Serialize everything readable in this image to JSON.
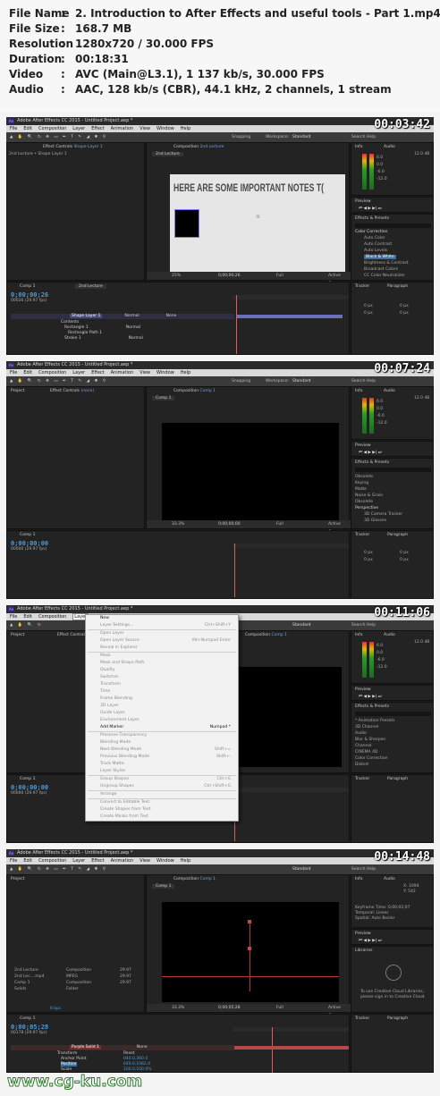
{
  "file_info": {
    "rows": [
      {
        "key": "File Name",
        "value": "2. Introduction to After Effects and useful tools - Part 1.mp4"
      },
      {
        "key": "File Size",
        "value": "168.7 MB"
      },
      {
        "key": "Resolution",
        "value": "1280x720 / 30.000 FPS"
      },
      {
        "key": "Duration",
        "value": "00:18:31"
      },
      {
        "key": "Video",
        "value": "AVC (Main@L3.1), 1 137 kb/s, 30.000 FPS"
      },
      {
        "key": "Audio",
        "value": "AAC, 128 kb/s (CBR), 44.1 kHz, 2 channels, 1 stream"
      }
    ]
  },
  "menu": [
    "File",
    "Edit",
    "Composition",
    "Layer",
    "Effect",
    "Animation",
    "View",
    "Window",
    "Help"
  ],
  "frames": [
    {
      "timestamp": "00:03:42",
      "title": "Adobe After Effects CC 2015 - Untitled Project.aep *",
      "left_tab": "Effect Controls",
      "left_tab_layer": "Shape Layer 1",
      "left_sub": "2nd Lecture • Shape Layer 1",
      "comp_tab": "Composition",
      "comp_name": "2nd Lecture",
      "comp_label": "2nd Lecture",
      "canvas_text": "HERE ARE SOME IMPORTANT NOTES T(",
      "zoom": "25%",
      "time_display": "0;00;00;26",
      "quality": "Full",
      "active_camera": "Active Cam",
      "tabs": [
        "Comp 1",
        "2nd Lecture"
      ],
      "timeline_time": "0;00;00;26",
      "timeline_sub": "00026 (29.97 fps)",
      "layer_rows": [
        "Shape Layer 1",
        "Contents",
        "Rectangle 1",
        "Rectangle Path 1",
        "Stroke 1"
      ],
      "blend": [
        "Normal",
        "Normal",
        "Normal"
      ],
      "parent": "None",
      "snapping": "Snapping",
      "workspace_label": "Workspace:",
      "workspace": "Standard",
      "search": "Search Help",
      "right_tabs": [
        "Info",
        "Audio"
      ],
      "audio_db": [
        "12.0 dB",
        "6.0",
        "0.0",
        "-6.0",
        "-12.0"
      ],
      "preview": "Preview",
      "effects_tab": "Effects & Presets",
      "effects_list": [
        "Color Correction",
        "Auto Color",
        "Auto Contrast",
        "Auto Levels",
        "Black & White",
        "Brightness & Contrast",
        "Broadcast Colors",
        "CC Color Neutralizer"
      ],
      "bottom_tabs": [
        "Tracker",
        "Paragraph"
      ],
      "px_vals": [
        "0 px",
        "0 px",
        "0 px",
        "0 px"
      ]
    },
    {
      "timestamp": "00:07:24",
      "title": "Adobe After Effects CC 2015 - Untitled Project.aep *",
      "left_tab": "Effect Controls",
      "left_tab_layer": "(none)",
      "left_tab_project": "Project",
      "comp_tab": "Composition",
      "comp_name": "Comp 1",
      "comp_label": "Comp 1",
      "zoom": "33.3%",
      "time_display": "0;00;00;00",
      "quality": "Full",
      "active_camera": "Active Cam",
      "tabs": [
        "Comp 1"
      ],
      "timeline_time": "0;00;00;00",
      "timeline_sub": "00000 (29.97 fps)",
      "snapping": "Snapping",
      "workspace_label": "Workspace:",
      "workspace": "Standard",
      "search": "Search Help",
      "right_tabs": [
        "Info",
        "Audio"
      ],
      "audio_db": [
        "12.0 dB",
        "6.0",
        "0.0",
        "-6.0",
        "-12.0"
      ],
      "preview": "Preview",
      "effects_tab": "Effects & Presets",
      "effects_list": [
        "Obsolete",
        "Keying",
        "Matte",
        "Noise & Grain",
        "Obsolete",
        "Perspective",
        "3D Camera Tracker",
        "3D Glasses"
      ],
      "bottom_tabs": [
        "Tracker",
        "Paragraph"
      ],
      "px_vals": [
        "0 px",
        "0 px",
        "0 px",
        "0 px"
      ]
    },
    {
      "timestamp": "00:11:06",
      "title": "Adobe After Effects CC 2015 - Untitled Project.aep *",
      "left_tab": "Effect Controls",
      "left_tab_project": "Project",
      "comp_tab": "Composition",
      "comp_name": "Comp 1",
      "tabs": [
        "Comp 1"
      ],
      "timeline_time": "0;00;00;00",
      "timeline_sub": "00000 (29.97 fps)",
      "workspace": "Standard",
      "search": "Search Help",
      "right_tabs": [
        "Info",
        "Audio"
      ],
      "audio_db": [
        "12.0 dB",
        "6.0",
        "0.0",
        "-6.0",
        "-12.0"
      ],
      "preview": "Preview",
      "effects_tab": "Effects & Presets",
      "effects_list": [
        "* Animation Presets",
        "3D Channel",
        "Audio",
        "Blur & Sharpen",
        "Channel",
        "CINEMA 4D",
        "Color Correction",
        "Distort"
      ],
      "bottom_tabs": [
        "Tracker",
        "Paragraph"
      ],
      "layer_menu": [
        {
          "label": "New",
          "shortcut": "",
          "dis": false
        },
        {
          "label": "Layer Settings...",
          "shortcut": "Ctrl+Shift+Y",
          "dis": true
        },
        {
          "sep": true
        },
        {
          "label": "Open Layer",
          "shortcut": "",
          "dis": true
        },
        {
          "label": "Open Layer Source",
          "shortcut": "Alt+Numpad Enter",
          "dis": true
        },
        {
          "label": "Reveal in Explorer",
          "shortcut": "",
          "dis": true
        },
        {
          "sep": true
        },
        {
          "label": "Mask",
          "shortcut": "",
          "dis": true
        },
        {
          "label": "Mask and Shape Path",
          "shortcut": "",
          "dis": true
        },
        {
          "label": "Quality",
          "shortcut": "",
          "dis": true
        },
        {
          "label": "Switches",
          "shortcut": "",
          "dis": true
        },
        {
          "label": "Transform",
          "shortcut": "",
          "dis": true
        },
        {
          "label": "Time",
          "shortcut": "",
          "dis": true
        },
        {
          "label": "Frame Blending",
          "shortcut": "",
          "dis": true
        },
        {
          "label": "3D Layer",
          "shortcut": "",
          "dis": true
        },
        {
          "label": "Guide Layer",
          "shortcut": "",
          "dis": true
        },
        {
          "label": "Environment Layer",
          "shortcut": "",
          "dis": true
        },
        {
          "label": "Add Marker",
          "shortcut": "Numpad *",
          "dis": false
        },
        {
          "sep": true
        },
        {
          "label": "Preserve Transparency",
          "shortcut": "",
          "dis": true
        },
        {
          "label": "Blending Mode",
          "shortcut": "",
          "dis": true
        },
        {
          "label": "Next Blending Mode",
          "shortcut": "Shift+=",
          "dis": true
        },
        {
          "label": "Previous Blending Mode",
          "shortcut": "Shift+-",
          "dis": true
        },
        {
          "label": "Track Matte",
          "shortcut": "",
          "dis": true
        },
        {
          "label": "Layer Styles",
          "shortcut": "",
          "dis": true
        },
        {
          "sep": true
        },
        {
          "label": "Group Shapes",
          "shortcut": "Ctrl+G",
          "dis": true
        },
        {
          "label": "Ungroup Shapes",
          "shortcut": "Ctrl+Shift+G",
          "dis": true
        },
        {
          "sep": true
        },
        {
          "label": "Arrange",
          "shortcut": "",
          "dis": true
        },
        {
          "sep": true
        },
        {
          "label": "Convert to Editable Text",
          "shortcut": "",
          "dis": true
        },
        {
          "label": "Create Shapes from Text",
          "shortcut": "",
          "dis": true
        },
        {
          "label": "Create Masks from Text",
          "shortcut": "",
          "dis": true
        }
      ]
    },
    {
      "timestamp": "00:14:48",
      "title": "Adobe After Effects CC 2015 - Untitled Project.aep *",
      "left_tab_project": "Project",
      "comp_tab": "Composition",
      "comp_name": "Comp 1",
      "comp_label": "Comp 1",
      "zoom": "33.3%",
      "time_display": "0;00;05;28",
      "quality": "Full",
      "active_camera": "Active Cam",
      "tabs": [
        "Comp 1"
      ],
      "timeline_time": "0;00;05;28",
      "timeline_sub": "00178 (29.97 fps)",
      "project_rows": [
        {
          "name": "2nd Lecture",
          "type": "Composition",
          "fps": "29.97"
        },
        {
          "name": "2nd Lec....mp4",
          "type": "MPEG",
          "fps": "29.97"
        },
        {
          "name": "Comp 1",
          "type": "Composition",
          "fps": "29.97"
        },
        {
          "name": "Solids",
          "type": "Folder",
          "fps": ""
        }
      ],
      "layer_rows": [
        "Purple Solid 1",
        "Transform",
        "Anchor Point",
        "Position",
        "Scale"
      ],
      "values": [
        "Reset",
        "640.0,360.0",
        "640.0,1082.0",
        "100.0,100.0%"
      ],
      "parent": "None",
      "info_lines": [
        "X: 1094",
        "Y: 542",
        "Keyframe Time: 0;00;02;07",
        "Temporal: Linear",
        "Spatial: Auto Bezier"
      ],
      "libraries": "Libraries",
      "libraries_msg1": "To use Creative Cloud Libraries,",
      "libraries_msg2": "please sign in to Creative Cloud.",
      "workspace": "Standard",
      "search": "Search Help",
      "right_tabs": [
        "Info",
        "Audio"
      ],
      "preview": "Preview",
      "bottom_tabs": [
        "Tracker",
        "Paragraph"
      ],
      "bpc": "8 bpc"
    }
  ],
  "watermark": "www.cg-ku.com",
  "colors": {
    "timecode_blue": "#4f9bd9",
    "playhead_red": "#e35a5a",
    "layer_bar_blue": "#6a6fbf",
    "layer_bar_red": "#b34a4a",
    "selection_highlight": "#3b6ea5"
  }
}
